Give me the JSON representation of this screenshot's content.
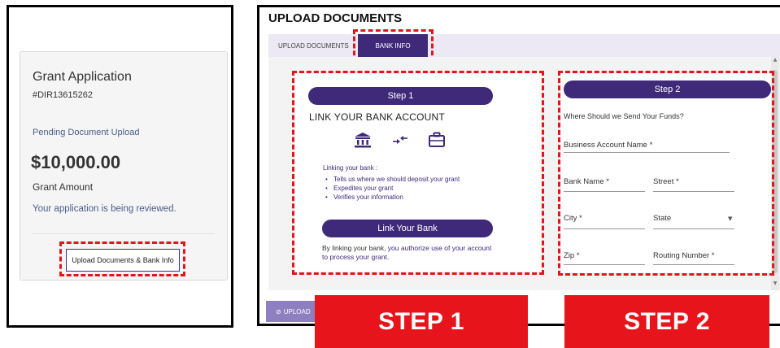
{
  "grant_card": {
    "title": "Grant Application",
    "id": "#DIR13615262",
    "status": "Pending Document Upload",
    "amount": "$10,000.00",
    "amount_label": "Grant Amount",
    "review_text": "Your application is being reviewed.",
    "upload_button": "Upload Documents & Bank Info"
  },
  "page": {
    "title": "UPLOAD DOCUMENTS",
    "tabs": [
      {
        "label": "UPLOAD DOCUMENTS",
        "active": false
      },
      {
        "label": "BANK INFO",
        "active": true
      }
    ]
  },
  "step1": {
    "pill": "Step 1",
    "heading": "LINK YOUR BANK ACCOUNT",
    "icons": [
      "bank-icon",
      "transfer-arrows-icon",
      "briefcase-icon"
    ],
    "linking_label": "Linking your bank :",
    "benefits": [
      "Tells us where we should deposit your grant",
      "Expedites your grant",
      "Verifies your information"
    ],
    "button": "Link Your Bank",
    "auth_prefix": "By linking your bank, ",
    "auth_highlight": "you authorize use of your account to process your grant."
  },
  "step2": {
    "pill": "Step 2",
    "question": "Where Should we Send Your Funds?",
    "fields": {
      "business_account_name": "Business Account Name *",
      "bank_name": "Bank Name *",
      "street": "Street *",
      "city": "City *",
      "state": "State",
      "zip": "Zip *",
      "routing_number": "Routing Number *"
    }
  },
  "bottom": {
    "upload_button": "UPLOAD",
    "step1_banner": "STEP 1",
    "step2_banner": "STEP 2"
  },
  "colors": {
    "accent_purple": "#3f2a7a",
    "highlight_red": "#e0161b",
    "banner_red": "#e8141b",
    "link_blue": "#4a5c8a"
  }
}
